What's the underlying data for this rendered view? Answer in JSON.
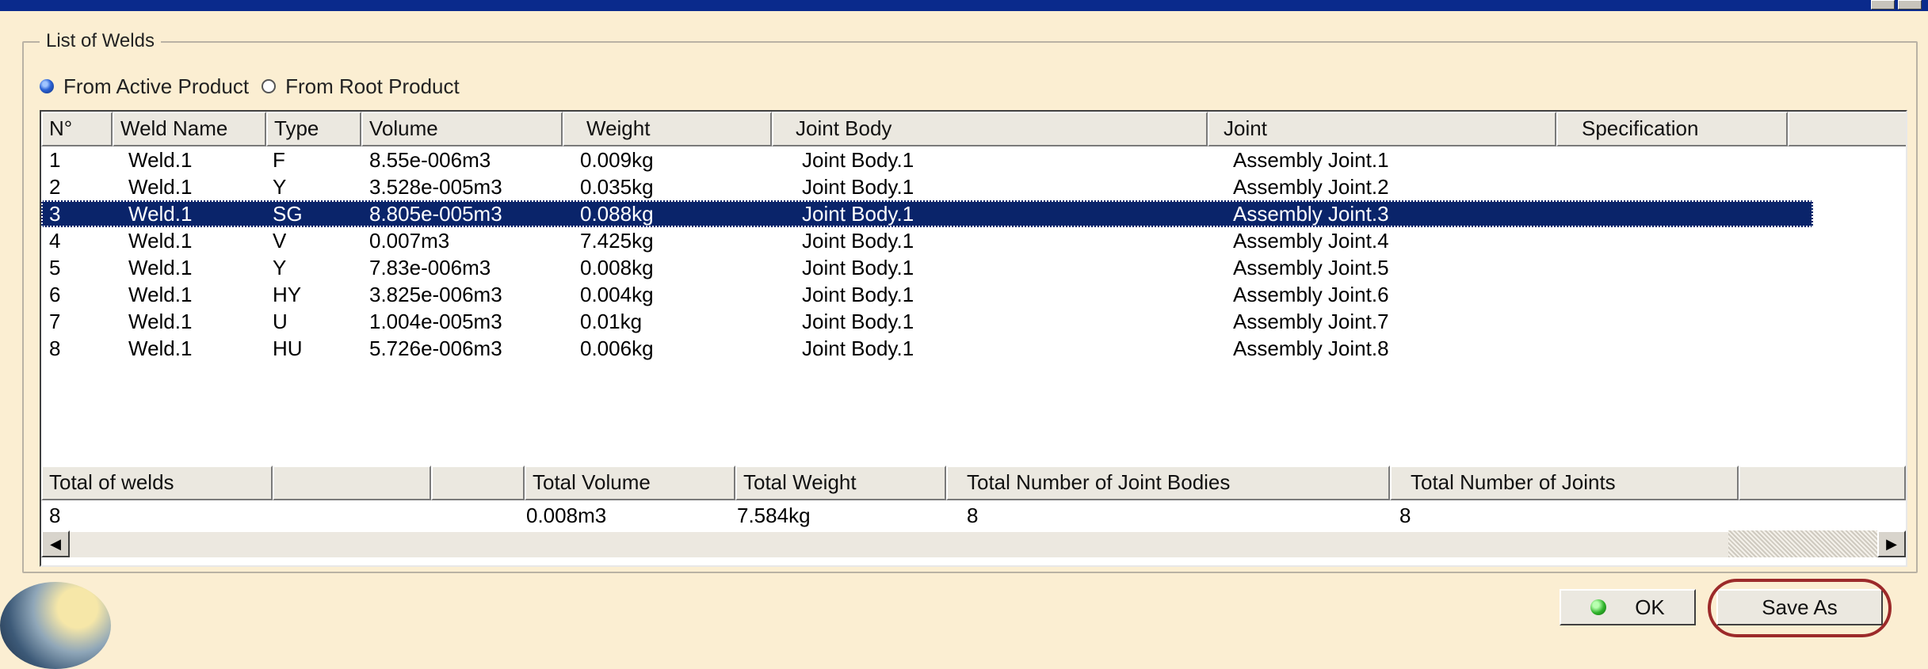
{
  "group": {
    "title": "List of Welds"
  },
  "radios": [
    {
      "label": "From Active Product",
      "selected": true
    },
    {
      "label": "From Root Product",
      "selected": false
    }
  ],
  "columns": [
    "N°",
    "Weld Name",
    "Type",
    "Volume",
    "Weight",
    "Joint Body",
    "Joint",
    "Specification"
  ],
  "rows": [
    {
      "n": "1",
      "name": "Weld.1",
      "type": "F",
      "volume": "8.55e-006m3",
      "weight": "0.009kg",
      "body": "Joint Body.1",
      "joint": "Assembly Joint.1",
      "spec": ""
    },
    {
      "n": "2",
      "name": "Weld.1",
      "type": "Y",
      "volume": "3.528e-005m3",
      "weight": "0.035kg",
      "body": "Joint Body.1",
      "joint": "Assembly Joint.2",
      "spec": ""
    },
    {
      "n": "3",
      "name": "Weld.1",
      "type": "SG",
      "volume": "8.805e-005m3",
      "weight": "0.088kg",
      "body": "Joint Body.1",
      "joint": "Assembly Joint.3",
      "spec": ""
    },
    {
      "n": "4",
      "name": "Weld.1",
      "type": "V",
      "volume": "0.007m3",
      "weight": "7.425kg",
      "body": "Joint Body.1",
      "joint": "Assembly Joint.4",
      "spec": ""
    },
    {
      "n": "5",
      "name": "Weld.1",
      "type": "Y",
      "volume": "7.83e-006m3",
      "weight": "0.008kg",
      "body": "Joint Body.1",
      "joint": "Assembly Joint.5",
      "spec": ""
    },
    {
      "n": "6",
      "name": "Weld.1",
      "type": "HY",
      "volume": "3.825e-006m3",
      "weight": "0.004kg",
      "body": "Joint Body.1",
      "joint": "Assembly Joint.6",
      "spec": ""
    },
    {
      "n": "7",
      "name": "Weld.1",
      "type": "U",
      "volume": "1.004e-005m3",
      "weight": "0.01kg",
      "body": "Joint Body.1",
      "joint": "Assembly Joint.7",
      "spec": ""
    },
    {
      "n": "8",
      "name": "Weld.1",
      "type": "HU",
      "volume": "5.726e-006m3",
      "weight": "0.006kg",
      "body": "Joint Body.1",
      "joint": "Assembly Joint.8",
      "spec": ""
    }
  ],
  "selected_row": "3",
  "totals": {
    "columns": [
      "Total of welds",
      "",
      "",
      "Total Volume",
      "Total Weight",
      "Total Number of Joint Bodies",
      "Total Number of Joints",
      ""
    ],
    "values": {
      "welds": "8",
      "volume": "0.008m3",
      "weight": "7.584kg",
      "bodies": "8",
      "joints": "8"
    }
  },
  "buttons": {
    "ok": "OK",
    "save_as": "Save As"
  },
  "colors": {
    "background": "#fbeed2",
    "selection": "#0a246a",
    "titlebar": "#0a2a8c",
    "highlight": "#9c2a2a"
  }
}
